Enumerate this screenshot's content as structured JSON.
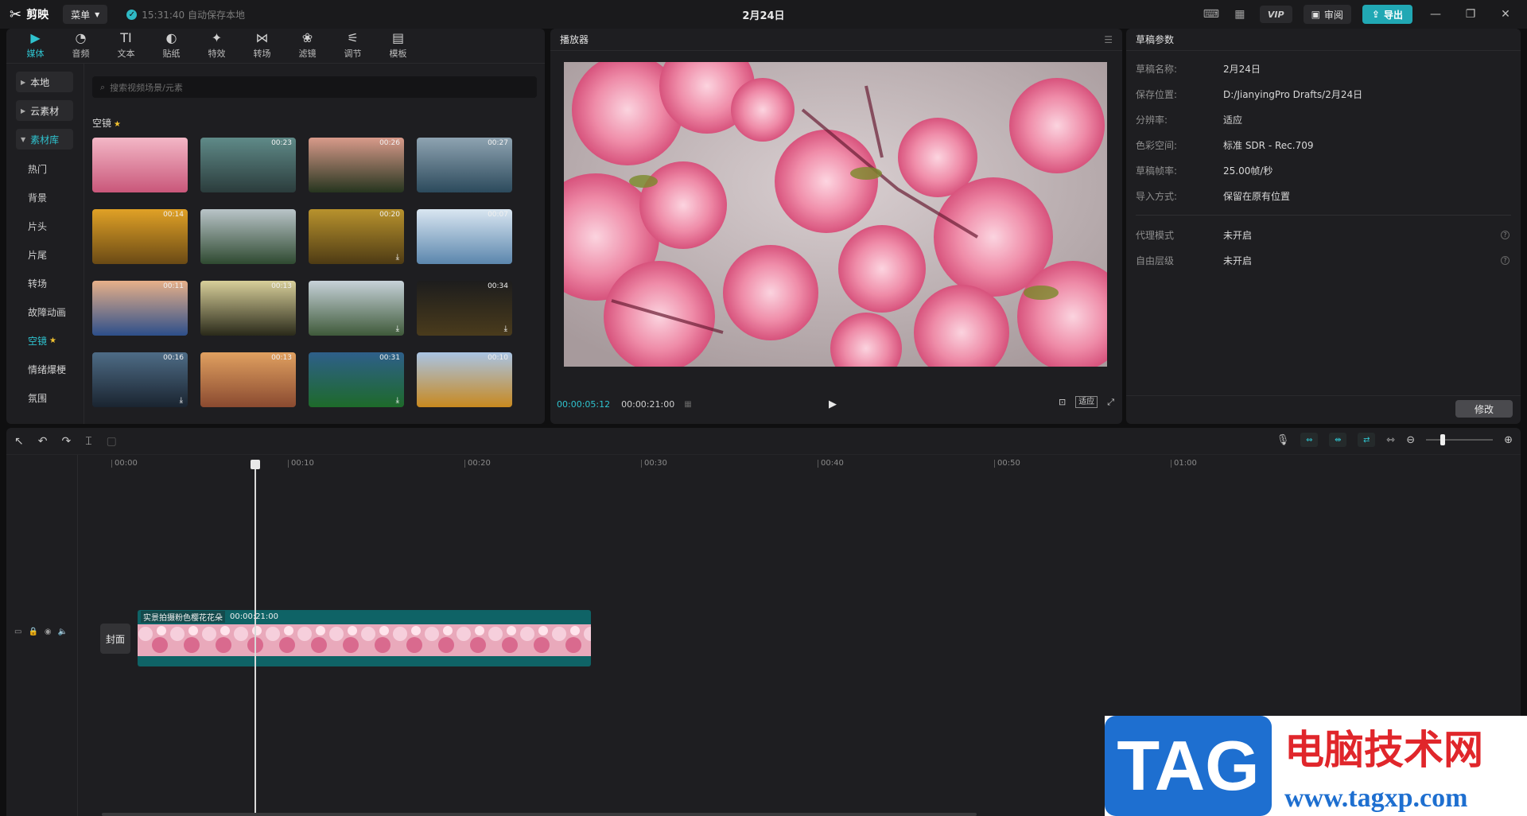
{
  "titlebar": {
    "app_name": "剪映",
    "menu_label": "菜单",
    "autosave": "15:31:40 自动保存本地",
    "window_title": "2月24日",
    "vip_label": "VIP",
    "review_label": "审阅",
    "export_label": "导出"
  },
  "media": {
    "tabs": [
      {
        "label": "媒体",
        "icon": "media-icon"
      },
      {
        "label": "音频",
        "icon": "audio-icon"
      },
      {
        "label": "文本",
        "icon": "text-icon"
      },
      {
        "label": "贴纸",
        "icon": "sticker-icon"
      },
      {
        "label": "特效",
        "icon": "effects-icon"
      },
      {
        "label": "转场",
        "icon": "transition-icon"
      },
      {
        "label": "滤镜",
        "icon": "filter-icon"
      },
      {
        "label": "调节",
        "icon": "adjust-icon"
      },
      {
        "label": "模板",
        "icon": "template-icon"
      }
    ],
    "side_buttons": [
      "本地",
      "云素材",
      "素材库"
    ],
    "side_items": [
      "热门",
      "背景",
      "片头",
      "片尾",
      "转场",
      "故障动画",
      "空镜",
      "情绪爆梗",
      "氛围"
    ],
    "search_placeholder": "搜索视频场景/元素",
    "category_title": "空镜",
    "thumbnails": [
      {
        "duration": "",
        "download": false,
        "colors": [
          "#f3b7c6",
          "#c9577a"
        ]
      },
      {
        "duration": "00:23",
        "download": false,
        "colors": [
          "#5f8a88",
          "#2b3c3c"
        ]
      },
      {
        "duration": "00:26",
        "download": false,
        "colors": [
          "#d89a8a",
          "#26351f"
        ]
      },
      {
        "duration": "00:27",
        "download": false,
        "colors": [
          "#8ea3b1",
          "#2c4a5c"
        ]
      },
      {
        "duration": "00:14",
        "download": false,
        "colors": [
          "#e0a126",
          "#6a4a15"
        ]
      },
      {
        "duration": "",
        "download": false,
        "colors": [
          "#b9c4c8",
          "#2f4a31"
        ]
      },
      {
        "duration": "00:20",
        "download": true,
        "colors": [
          "#b8922d",
          "#4e3b14"
        ]
      },
      {
        "duration": "00:07",
        "download": false,
        "colors": [
          "#d9e6f1",
          "#5b86ad"
        ]
      },
      {
        "duration": "00:11",
        "download": false,
        "colors": [
          "#e7b089",
          "#2d4f8a"
        ]
      },
      {
        "duration": "00:13",
        "download": false,
        "colors": [
          "#d8cf9a",
          "#2a2a1a"
        ]
      },
      {
        "duration": "",
        "download": true,
        "colors": [
          "#c7d2d9",
          "#3f5a3a"
        ]
      },
      {
        "duration": "00:34",
        "download": true,
        "colors": [
          "#1d1d1d",
          "#4a3b1c"
        ]
      },
      {
        "duration": "00:16",
        "download": true,
        "colors": [
          "#4e6c86",
          "#1a2430"
        ]
      },
      {
        "duration": "00:13",
        "download": false,
        "colors": [
          "#e0a060",
          "#8a4a30"
        ]
      },
      {
        "duration": "00:31",
        "download": true,
        "colors": [
          "#2e5f8a",
          "#1e6a2a"
        ]
      },
      {
        "duration": "00:10",
        "download": false,
        "colors": [
          "#a9c4e4",
          "#c8891f"
        ]
      }
    ]
  },
  "player": {
    "title": "播放器",
    "current_time": "00:00:05:12",
    "total_time": "00:00:21:00",
    "fit_label": "适应"
  },
  "draft": {
    "title": "草稿参数",
    "rows": [
      {
        "key": "草稿名称:",
        "value": "2月24日"
      },
      {
        "key": "保存位置:",
        "value": "D:/JianyingPro Drafts/2月24日"
      },
      {
        "key": "分辨率:",
        "value": "适应"
      },
      {
        "key": "色彩空间:",
        "value": "标准 SDR - Rec.709"
      },
      {
        "key": "草稿帧率:",
        "value": "25.00帧/秒"
      },
      {
        "key": "导入方式:",
        "value": "保留在原有位置"
      }
    ],
    "rows2": [
      {
        "key": "代理模式",
        "value": "未开启"
      },
      {
        "key": "自由层级",
        "value": "未开启"
      }
    ],
    "modify_label": "修改"
  },
  "timeline": {
    "ruler": [
      "00:00",
      "00:10",
      "00:20",
      "00:30",
      "00:40",
      "00:50",
      "01:00"
    ],
    "cover_label": "封面",
    "clip_name": "实景拍摄粉色樱花花朵",
    "clip_duration": "00:00:21:00"
  },
  "watermark": {
    "tag": "TAG",
    "site_name": "电脑技术网",
    "url": "www.tagxp.com"
  }
}
